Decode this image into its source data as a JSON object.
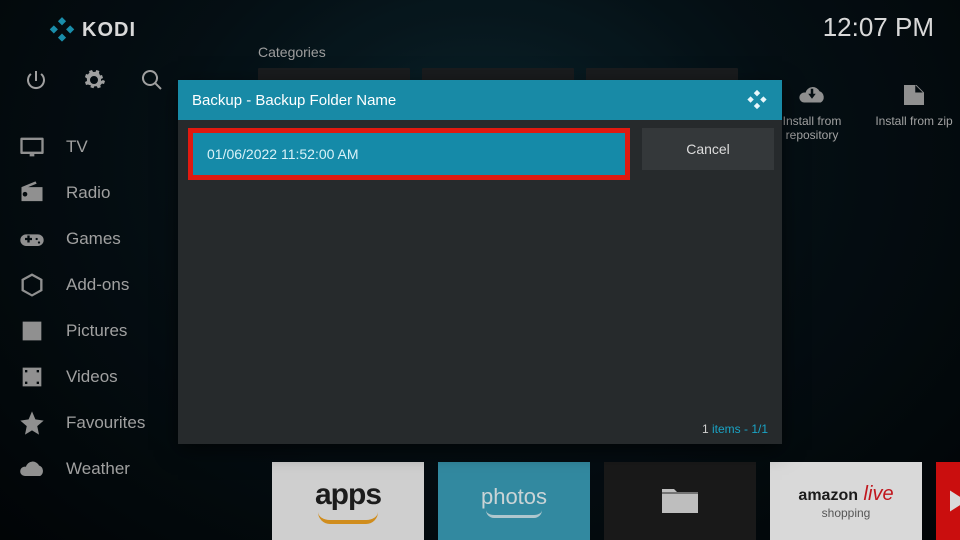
{
  "header": {
    "brand": "KODI",
    "clock": "12:07 PM"
  },
  "sidebar": {
    "items": [
      {
        "label": "TV",
        "icon": "tv-icon"
      },
      {
        "label": "Radio",
        "icon": "radio-icon"
      },
      {
        "label": "Games",
        "icon": "gamepad-icon"
      },
      {
        "label": "Add-ons",
        "icon": "box-icon"
      },
      {
        "label": "Pictures",
        "icon": "picture-icon"
      },
      {
        "label": "Videos",
        "icon": "film-icon"
      },
      {
        "label": "Favourites",
        "icon": "star-icon"
      },
      {
        "label": "Weather",
        "icon": "cloud-icon"
      }
    ]
  },
  "categories_label": "Categories",
  "install_tiles": [
    {
      "label": "Install from repository"
    },
    {
      "label": "Install from zip"
    }
  ],
  "bottom_tiles": {
    "apps_label": "apps",
    "photos_label": "photos",
    "amazon_line1": "amazon",
    "amazon_live": " live",
    "amazon_line2": "shopping"
  },
  "dialog": {
    "title": "Backup - Backup Folder Name",
    "rows": [
      {
        "label": "01/06/2022 11:52:00 AM"
      }
    ],
    "cancel_label": "Cancel",
    "footer_prefix": "1",
    "footer_middle": " items - ",
    "footer_page": "1/1"
  }
}
